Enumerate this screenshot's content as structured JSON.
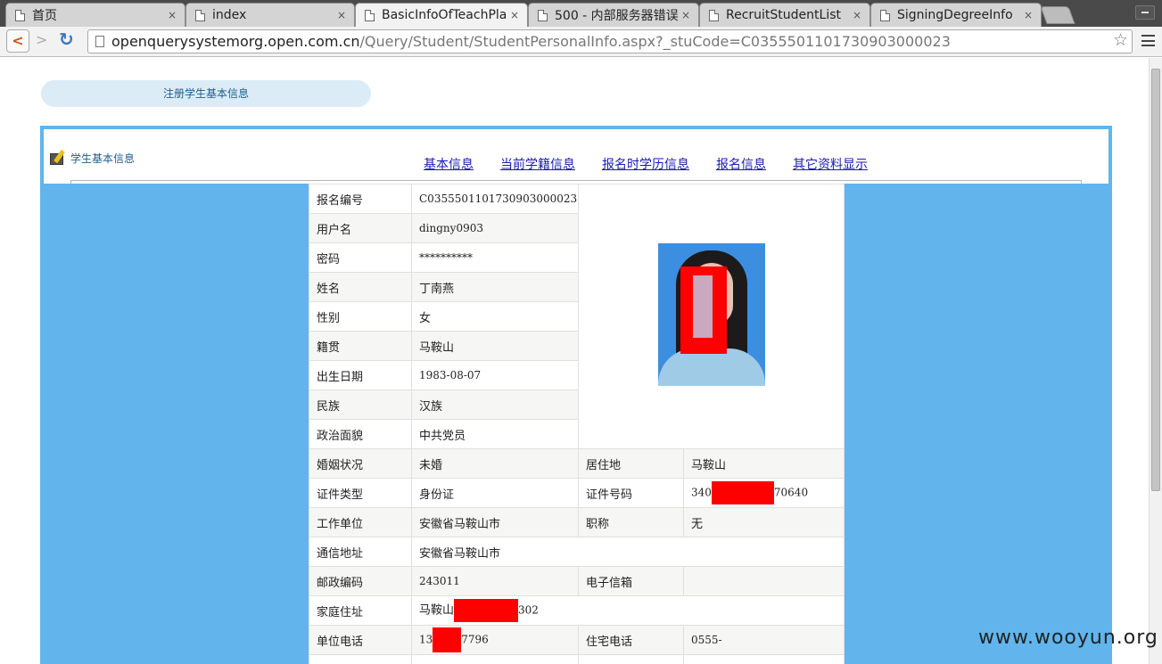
{
  "browser": {
    "tabs": [
      {
        "title": "首页",
        "close": "×",
        "active": false
      },
      {
        "title": "index",
        "close": "×",
        "active": false
      },
      {
        "title": "BasicInfoOfTeachPla",
        "close": "×",
        "active": true
      },
      {
        "title": "500 - 内部服务器错误",
        "close": "×",
        "active": false
      },
      {
        "title": "RecruitStudentList",
        "close": "×",
        "active": false
      },
      {
        "title": "SigningDegreeInfo",
        "close": "×",
        "active": false
      }
    ],
    "back_symbol": "<",
    "forward_symbol": ">",
    "reload_symbol": "↻",
    "url_host": "openquerysystemorg.open.com.cn",
    "url_path": "/Query/Student/StudentPersonalInfo.aspx?_stuCode=C0355501101730903000023",
    "star_symbol": "☆"
  },
  "page": {
    "register_pill": "注册学生基本信息",
    "student_label": "学生基本信息",
    "nav_links": [
      "基本信息",
      "当前学籍信息",
      "报名时学历信息",
      "报名信息",
      "其它资料显示"
    ]
  },
  "info": {
    "reg_no_label": "报名编号",
    "reg_no": "C0355501101730903000023",
    "username_label": "用户名",
    "username": "dingny0903",
    "password_label": "密码",
    "password": "**********",
    "name_label": "姓名",
    "name": "丁南燕",
    "gender_label": "性别",
    "gender": "女",
    "native_label": "籍贯",
    "native": "马鞍山",
    "birth_label": "出生日期",
    "birth": "1983-08-07",
    "ethnic_label": "民族",
    "ethnic": "汉族",
    "political_label": "政治面貌",
    "political": "中共党员",
    "marital_label": "婚姻状况",
    "marital": "未婚",
    "residence_label": "居住地",
    "residence": "马鞍山",
    "id_type_label": "证件类型",
    "id_type": "身份证",
    "id_no_label": "证件号码",
    "id_no_prefix": "340",
    "id_no_suffix": "70640",
    "employer_label": "工作单位",
    "employer": "安徽省马鞍山市",
    "title_label": "职称",
    "title": "无",
    "address_label": "通信地址",
    "address": "安徽省马鞍山市",
    "postcode_label": "邮政编码",
    "postcode": "243011",
    "email_label": "电子信箱",
    "email": "",
    "home_address_label": "家庭住址",
    "home_address_prefix": "马鞍山",
    "home_address_suffix": "302",
    "work_phone_label": "单位电话",
    "work_phone_prefix": "13",
    "work_phone_suffix": "7796",
    "home_phone_label": "住宅电话",
    "home_phone": "0555-"
  },
  "colors": {
    "frame": "#61b5ec",
    "redaction": "#ff0000",
    "link": "#1b1bb0"
  },
  "watermark": "www.wooyun.org"
}
